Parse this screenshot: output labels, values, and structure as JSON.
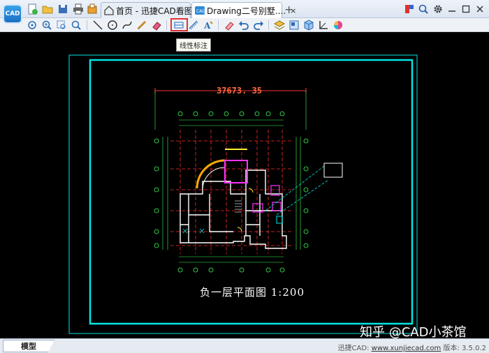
{
  "app": {
    "logo_text": "CAD"
  },
  "tabs": [
    {
      "label": "首页 - 迅捷CAD看图",
      "icon": "home-icon"
    },
    {
      "label": "Drawing二号别墅....",
      "icon": "cad-file-icon",
      "close": "×"
    }
  ],
  "tab_add": "+",
  "tooltip": "线性标注",
  "drawing": {
    "dimension_value": "37673. 35",
    "plan_title": "负一层平面图  1:200"
  },
  "watermark": "知乎 @CAD小茶馆",
  "statusbar": {
    "model_tab": "模型",
    "product_label": "迅捷CAD:",
    "website": "www.xunjiecad.com",
    "version_label": "版本: 3.5.0.2"
  },
  "colors": {
    "canvas_bg": "#000000",
    "frame_cyan": "#00e5e5",
    "highlight_red": "#e23232",
    "dimension_orange": "#ff6a3d"
  }
}
